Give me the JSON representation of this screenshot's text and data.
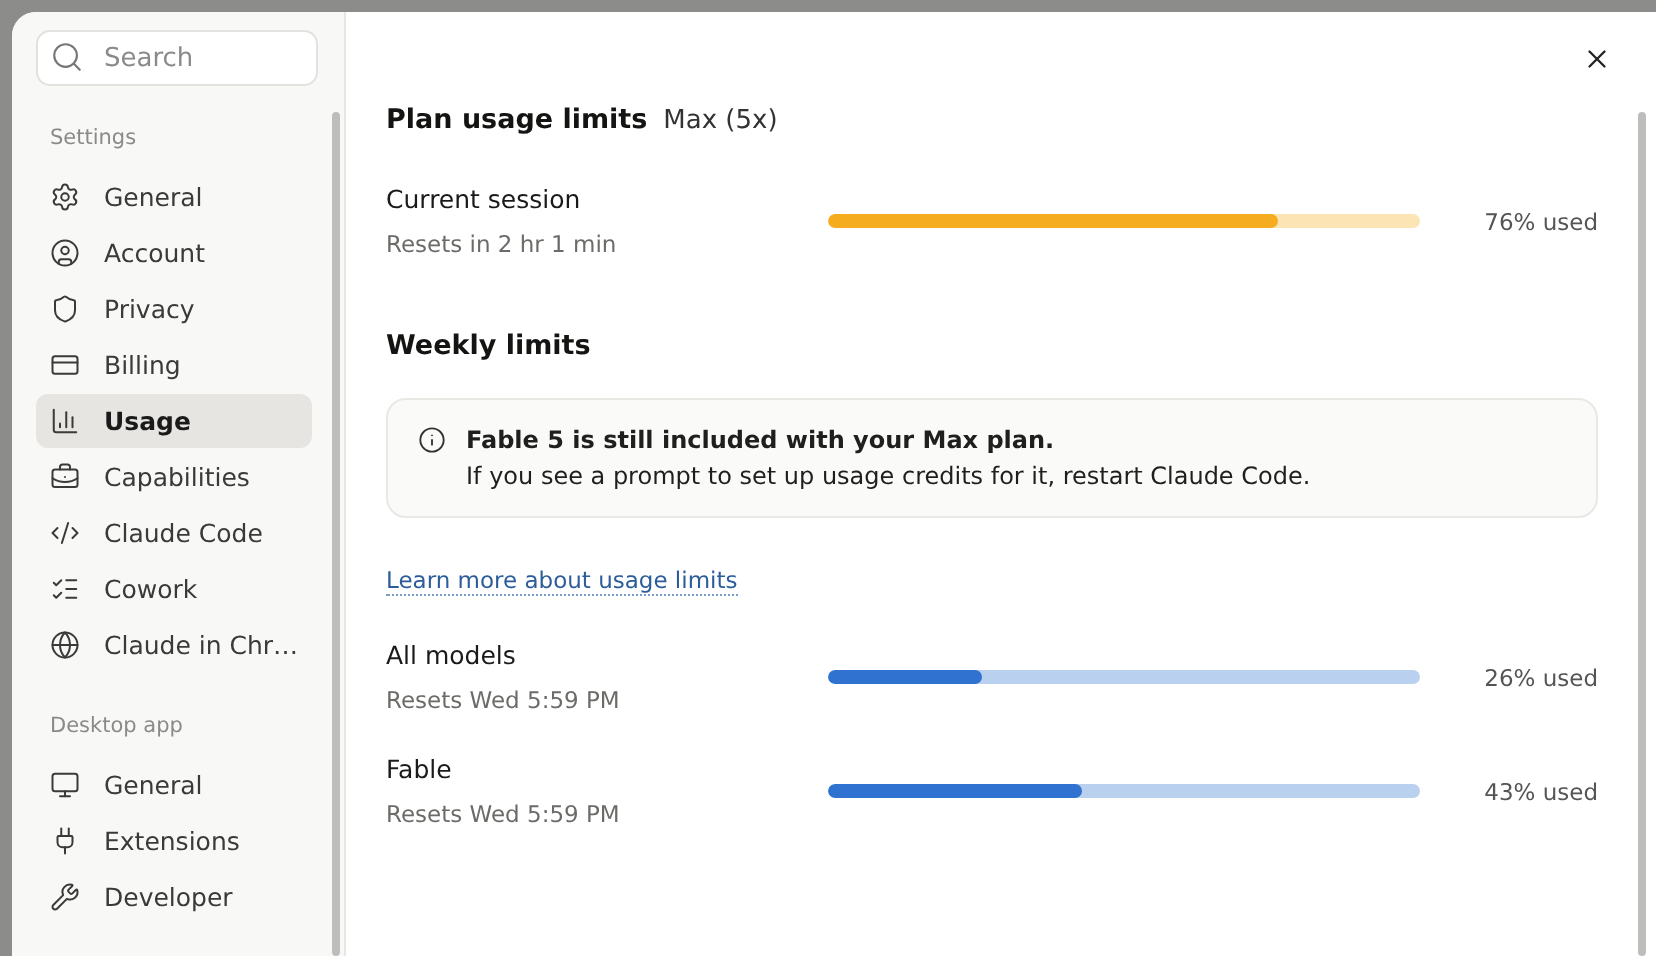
{
  "sidebar": {
    "search": {
      "placeholder": "Search"
    },
    "sections": [
      {
        "title": "Settings",
        "items": [
          {
            "label": "General",
            "selected": false
          },
          {
            "label": "Account",
            "selected": false
          },
          {
            "label": "Privacy",
            "selected": false
          },
          {
            "label": "Billing",
            "selected": false
          },
          {
            "label": "Usage",
            "selected": true
          },
          {
            "label": "Capabilities",
            "selected": false
          },
          {
            "label": "Claude Code",
            "selected": false
          },
          {
            "label": "Cowork",
            "selected": false
          },
          {
            "label": "Claude in Chr…",
            "selected": false
          }
        ]
      },
      {
        "title": "Desktop app",
        "items": [
          {
            "label": "General",
            "selected": false
          },
          {
            "label": "Extensions",
            "selected": false
          },
          {
            "label": "Developer",
            "selected": false
          }
        ]
      }
    ]
  },
  "main": {
    "title": "Plan usage limits",
    "plan": "Max (5x)",
    "session": [
      {
        "name": "Current session",
        "resets": "Resets in 2 hr 1 min",
        "level": 0.76,
        "reading": "76% used",
        "color": "#f5ad1f"
      }
    ],
    "weekly_title": "Weekly limits",
    "notice": {
      "text": "**Fable 5 is still included with your Max plan.**\nIf you see a prompt to set up usage credits for it, restart Claude Code."
    },
    "link": "Learn more about usage limits",
    "weekly": [
      {
        "name": "All models",
        "resets": "Resets Wed 5:59 PM",
        "level": 0.26,
        "reading": "26% used",
        "color": "#2f72d0"
      },
      {
        "name": "Fable",
        "resets": "Resets Wed 5:59 PM",
        "level": 0.43,
        "reading": "43% used",
        "color": "#2f72d0"
      }
    ]
  }
}
